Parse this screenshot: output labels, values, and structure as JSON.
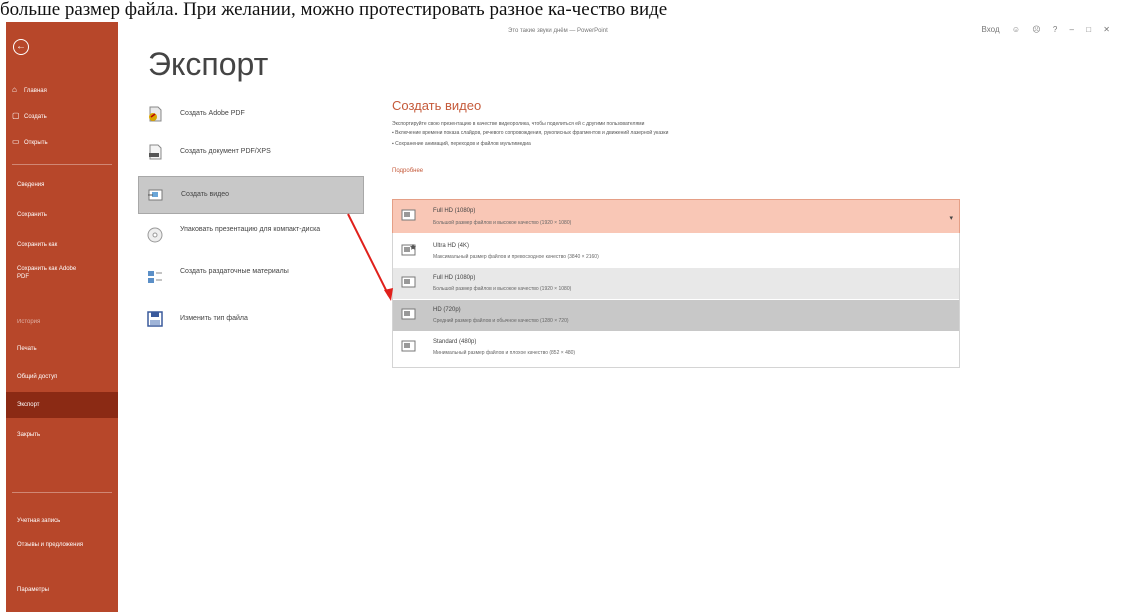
{
  "top_caption": "больше размер файла. При желании, можно протестировать разное ка-чество виде",
  "window": {
    "doc_title": "Это такие звуки днём — PowerPoint",
    "signin": "Вход",
    "controls": [
      "☺",
      "☹",
      "?",
      "–",
      "□",
      "✕"
    ]
  },
  "sidebar": {
    "back": "←",
    "items": [
      {
        "label": "Главная",
        "icon": "⌂"
      },
      {
        "label": "Создать",
        "icon": "▢"
      },
      {
        "label": "Открыть",
        "icon": "▭"
      },
      {
        "label": "Сведения"
      },
      {
        "label": "Сохранить"
      },
      {
        "label": "Сохранить как"
      },
      {
        "label": "Сохранить как Adobe PDF"
      },
      {
        "label": "История"
      },
      {
        "label": "Печать"
      },
      {
        "label": "Общий доступ"
      },
      {
        "label": "Экспорт"
      },
      {
        "label": "Закрыть"
      },
      {
        "label": "Учетная запись"
      },
      {
        "label": "Отзывы и предложения"
      },
      {
        "label": "Параметры"
      }
    ]
  },
  "page": {
    "title": "Экспорт"
  },
  "export_options": [
    {
      "label": "Создать Adobe PDF",
      "icon": "adobe-pdf-icon"
    },
    {
      "label": "Создать документ PDF/XPS",
      "icon": "pdf-xps-icon"
    },
    {
      "label": "Создать видео",
      "icon": "video-icon"
    },
    {
      "label": "Упаковать презентацию для компакт-диска",
      "icon": "cd-icon"
    },
    {
      "label": "Создать раздаточные материалы",
      "icon": "handouts-icon"
    },
    {
      "label": "Изменить тип файла",
      "icon": "file-type-icon"
    }
  ],
  "video_panel": {
    "title": "Создать видео",
    "description": "Экспортируйте свою презентацию в качестве видеоролика, чтобы поделиться ей с другими пользователями",
    "bullets": [
      "Включение времени показа слайдов, речевого сопровождения, рукописных фрагментов и движений лазерной указки",
      "Сохранение анимаций, переходов и файлов мультимедиа"
    ],
    "more": "Подробнее",
    "selected": {
      "title": "Full HD (1080p)",
      "desc": "Большой размер файлов и высокое качество (1920 × 1080)"
    },
    "options": [
      {
        "title": "Ultra HD (4K)",
        "desc": "Максимальный размер файлов и превосходное качество (3840 × 2160)"
      },
      {
        "title": "Full HD (1080p)",
        "desc": "Большой размер файлов и высокое качество (1920 × 1080)"
      },
      {
        "title": "HD (720p)",
        "desc": "Средний размер файлов и обычное качество (1280 × 720)"
      },
      {
        "title": "Standard (480p)",
        "desc": "Минимальный размер файлов и плохое качество (852 × 480)"
      }
    ]
  },
  "colors": {
    "accent": "#b7472a",
    "accent_dark": "#8b2a14",
    "highlight": "#f9c7b6",
    "annotation_arrow": "#e0201b"
  }
}
